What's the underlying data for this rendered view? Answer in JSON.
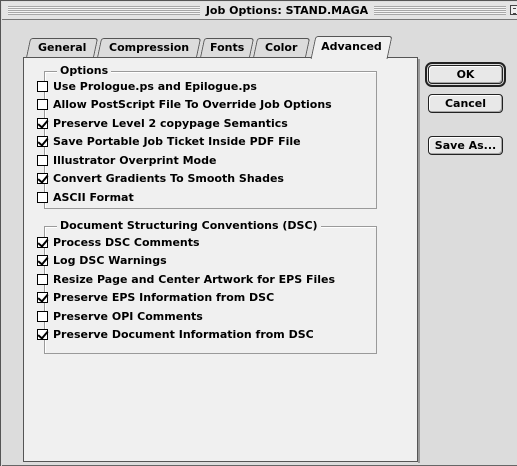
{
  "window": {
    "title": "Job Options: STAND.MAGA"
  },
  "tabs": [
    {
      "label": "General",
      "active": false
    },
    {
      "label": "Compression",
      "active": false
    },
    {
      "label": "Fonts",
      "active": false
    },
    {
      "label": "Color",
      "active": false
    },
    {
      "label": "Advanced",
      "active": true
    }
  ],
  "options_group": {
    "title": "Options",
    "items": [
      {
        "label": "Use Prologue.ps and Epilogue.ps",
        "checked": false
      },
      {
        "label": "Allow PostScript File To Override Job Options",
        "checked": false
      },
      {
        "label": "Preserve Level 2 copypage Semantics",
        "checked": true
      },
      {
        "label": "Save Portable Job Ticket Inside PDF File",
        "checked": true
      },
      {
        "label": "Illustrator Overprint Mode",
        "checked": false
      },
      {
        "label": "Convert Gradients To Smooth Shades",
        "checked": true
      },
      {
        "label": "ASCII Format",
        "checked": false
      }
    ]
  },
  "dsc_group": {
    "title": "Document Structuring Conventions (DSC)",
    "items": [
      {
        "label": "Process DSC Comments",
        "checked": true
      },
      {
        "label": "Log DSC Warnings",
        "checked": true
      },
      {
        "label": "Resize Page and Center Artwork for EPS Files",
        "checked": false
      },
      {
        "label": "Preserve EPS Information from DSC",
        "checked": true
      },
      {
        "label": "Preserve OPI Comments",
        "checked": false
      },
      {
        "label": "Preserve Document Information from DSC",
        "checked": true
      }
    ]
  },
  "buttons": {
    "ok": "OK",
    "cancel": "Cancel",
    "save_as": "Save As..."
  }
}
